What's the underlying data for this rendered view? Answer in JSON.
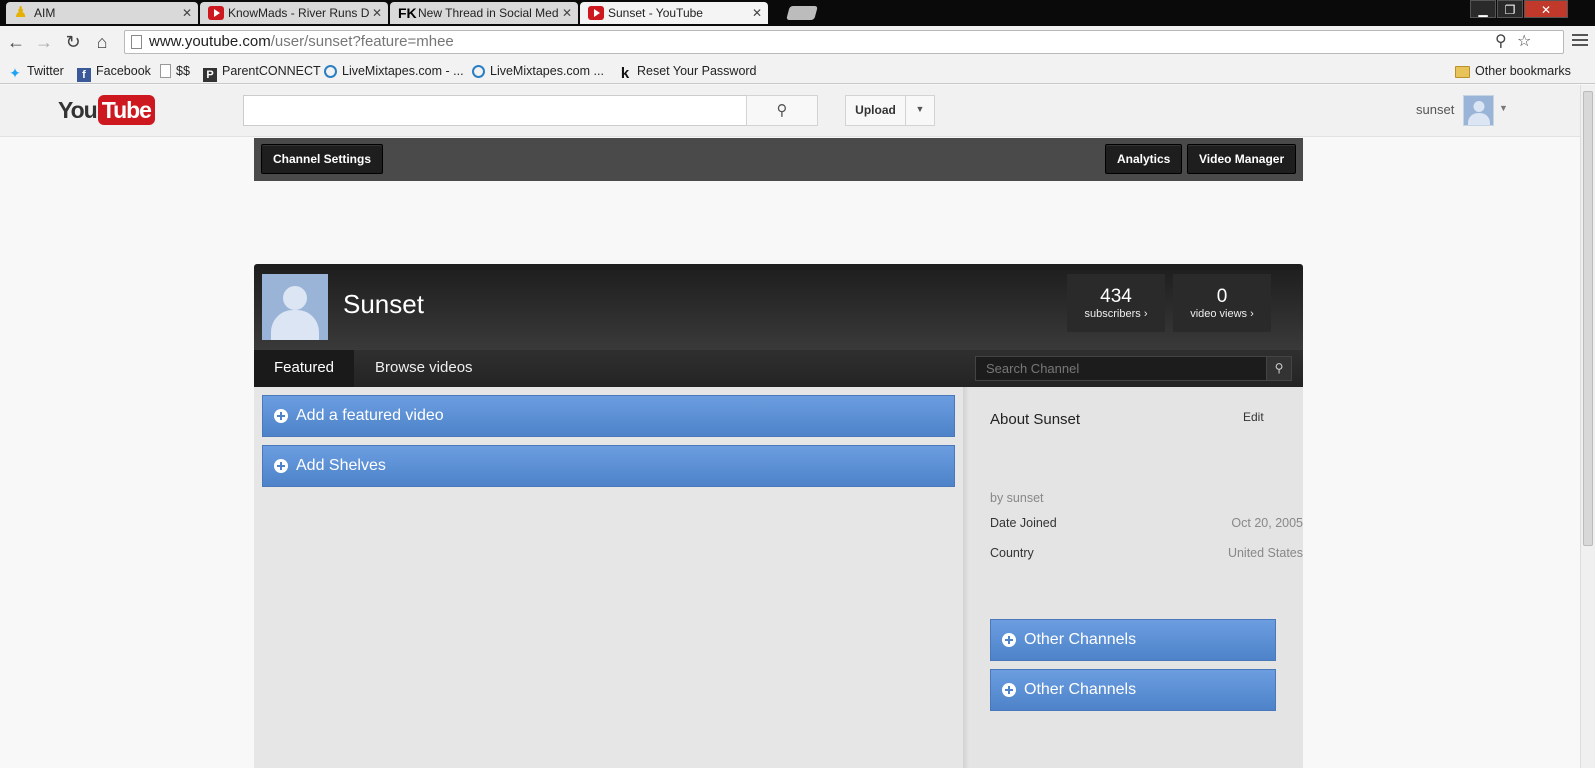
{
  "browser": {
    "tabs": [
      {
        "label": "AIM",
        "icon": "aim-icon"
      },
      {
        "label": "KnowMads - River Runs D",
        "icon": "youtube-favicon"
      },
      {
        "label": "New Thread in Social Med",
        "icon": "fk-favicon"
      },
      {
        "label": "Sunset - YouTube",
        "icon": "youtube-favicon",
        "active": true
      }
    ],
    "url_host": "www.youtube.com",
    "url_path": "/user/sunset?feature=mhee",
    "bookmarks": [
      {
        "label": "Twitter",
        "icon": "twitter-icon"
      },
      {
        "label": "Facebook",
        "icon": "facebook-icon"
      },
      {
        "label": "$$",
        "icon": "page-icon"
      },
      {
        "label": "ParentCONNECT",
        "icon": "parentconnect-icon"
      },
      {
        "label": "LiveMixtapes.com - ...",
        "icon": "livemixtapes-icon"
      },
      {
        "label": "LiveMixtapes.com ...",
        "icon": "livemixtapes-icon"
      },
      {
        "label": "Reset Your Password",
        "icon": "klout-icon"
      }
    ],
    "other_bookmarks": "Other bookmarks"
  },
  "masthead": {
    "logo_you": "You",
    "logo_tube": "Tube",
    "upload_label": "Upload",
    "username": "sunset"
  },
  "channel_bar": {
    "settings_label": "Channel Settings",
    "analytics_label": "Analytics",
    "video_manager_label": "Video Manager"
  },
  "channel": {
    "title": "Sunset",
    "subscribers_count": "434",
    "subscribers_label": "subscribers ›",
    "views_count": "0",
    "views_label": "video views ›",
    "tabs": [
      "Featured",
      "Browse videos"
    ],
    "search_placeholder": "Search Channel"
  },
  "main": {
    "add_featured_label": "Add a featured video",
    "add_shelves_label": "Add Shelves"
  },
  "about": {
    "title": "About Sunset",
    "edit_label": "Edit",
    "by": "by sunset",
    "date_joined_label": "Date Joined",
    "date_joined_value": "Oct 20, 2005",
    "country_label": "Country",
    "country_value": "United States",
    "other_channels_1": "Other Channels",
    "other_channels_2": "Other Channels"
  },
  "colors": {
    "youtube_red": "#cc181e",
    "blue_bar": "#4e83c9",
    "channel_dark": "#2a2a2a"
  }
}
